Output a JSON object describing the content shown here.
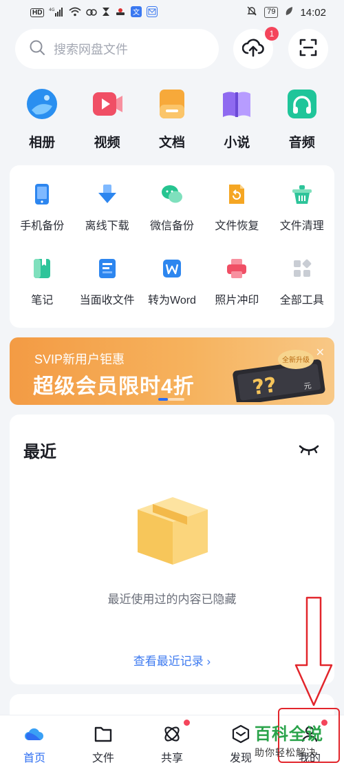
{
  "status_bar": {
    "left_items": [
      "HD",
      "4G",
      "wifi-icon",
      "cloud-icon",
      "hourglass-icon",
      "app-icon",
      "translate-icon",
      "mail-icon"
    ],
    "battery": "79",
    "time": "14:02"
  },
  "header": {
    "search_placeholder": "搜索网盘文件",
    "upload_badge": "1"
  },
  "quick_entries": [
    {
      "label": "相册",
      "icon": "photo-album-icon",
      "color": "#2a8ff0"
    },
    {
      "label": "视频",
      "icon": "video-icon",
      "color": "#f04f65"
    },
    {
      "label": "文档",
      "icon": "document-icon",
      "color": "#f7a93a"
    },
    {
      "label": "小说",
      "icon": "novel-book-icon",
      "color": "#8f6af0"
    },
    {
      "label": "音频",
      "icon": "headphone-icon",
      "color": "#1fc59a"
    }
  ],
  "tools": [
    {
      "label": "手机备份",
      "icon": "phone-backup-icon",
      "color": "#2d86ef"
    },
    {
      "label": "离线下载",
      "icon": "offline-download-icon",
      "color": "#2d86ef"
    },
    {
      "label": "微信备份",
      "icon": "wechat-backup-icon",
      "color": "#26c490"
    },
    {
      "label": "文件恢复",
      "icon": "file-restore-icon",
      "color": "#f5a623"
    },
    {
      "label": "文件清理",
      "icon": "file-clean-icon",
      "color": "#2ec49a"
    },
    {
      "label": "笔记",
      "icon": "note-icon",
      "color": "#2ec49a"
    },
    {
      "label": "当面收文件",
      "icon": "receive-file-icon",
      "color": "#2d86ef"
    },
    {
      "label": "转为Word",
      "icon": "word-convert-icon",
      "color": "#2d86ef"
    },
    {
      "label": "照片冲印",
      "icon": "photo-print-icon",
      "color": "#f04f65"
    },
    {
      "label": "全部工具",
      "icon": "all-tools-icon",
      "color": "#c9cdd4"
    }
  ],
  "banner": {
    "subtitle": "SVIP新用户钜惠",
    "title": "超级会员限时4折",
    "tag": "全新升级",
    "ticket_text": "??",
    "ticket_unit": "元"
  },
  "recent": {
    "title": "最近",
    "empty_text": "最近使用过的内容已隐藏",
    "link_text": "查看最近记录 ›"
  },
  "tabs": [
    {
      "label": "首页",
      "icon": "home-cloud-icon",
      "active": true
    },
    {
      "label": "文件",
      "icon": "folder-icon",
      "active": false
    },
    {
      "label": "共享",
      "icon": "share-icon",
      "active": false,
      "dot": true
    },
    {
      "label": "发现",
      "icon": "discover-icon",
      "active": false
    },
    {
      "label": "我的",
      "icon": "profile-icon",
      "active": false,
      "dot": true
    }
  ],
  "watermark": {
    "title": "百科全说",
    "subtitle": "助你轻松解决"
  },
  "colors": {
    "accent": "#2f6ff2",
    "badge": "#f4455b",
    "banner": "#f39b44"
  }
}
